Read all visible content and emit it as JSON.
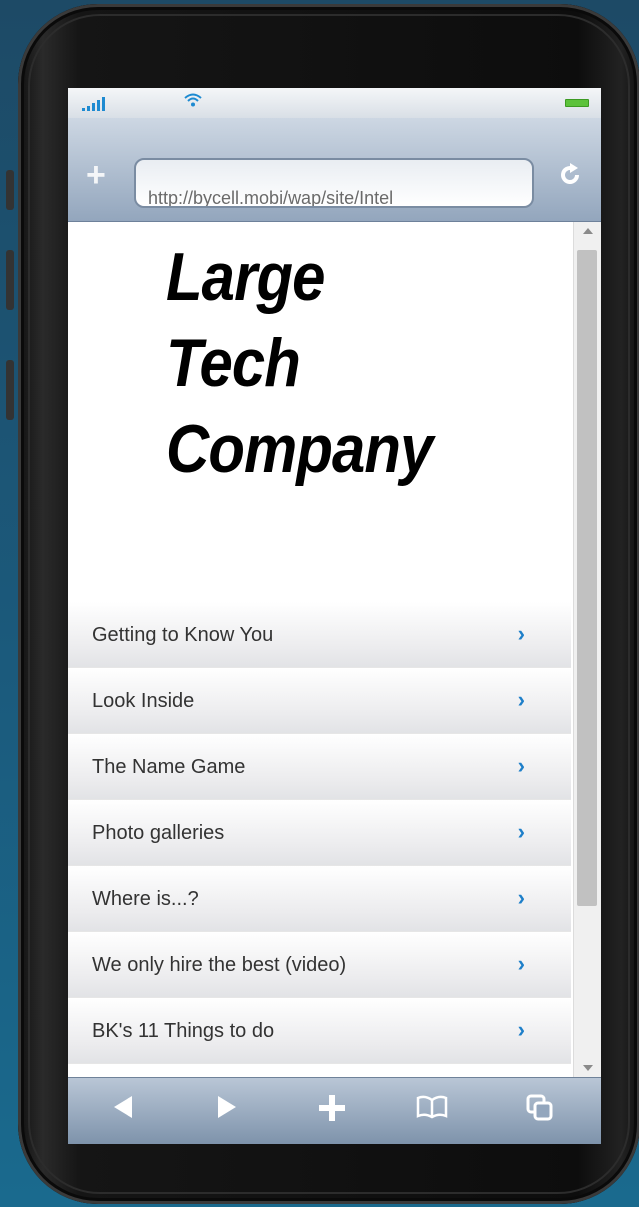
{
  "status_bar": {
    "signal_icon": "signal-bars-icon",
    "wifi_icon": "wifi-icon",
    "battery_icon": "battery-icon",
    "battery_level": 1.0,
    "accent": "#1d8ad1",
    "battery_color": "#5cc23b"
  },
  "browser": {
    "add_tab_glyph": "+",
    "url": "http://bycell.mobi/wap/site/Intel",
    "reload_glyph": "↻"
  },
  "page": {
    "logo_lines": [
      "Large",
      "Tech",
      "Company"
    ],
    "menu": [
      {
        "label": "Getting to Know You",
        "chevron": "›"
      },
      {
        "label": "Look Inside",
        "chevron": "›"
      },
      {
        "label": "The Name Game",
        "chevron": "›"
      },
      {
        "label": "Photo galleries",
        "chevron": "›"
      },
      {
        "label": "Where is...?",
        "chevron": "›"
      },
      {
        "label": "We only hire the best (video)",
        "chevron": "›"
      },
      {
        "label": "BK's 11 Things to do",
        "chevron": "›"
      }
    ],
    "chevron_color": "#1e7fc9"
  },
  "toolbar": {
    "back_glyph": "◀",
    "forward_glyph": "▶",
    "add_glyph": "+",
    "bookmarks_glyph": "🕮",
    "tabs_glyph": "⧉"
  }
}
